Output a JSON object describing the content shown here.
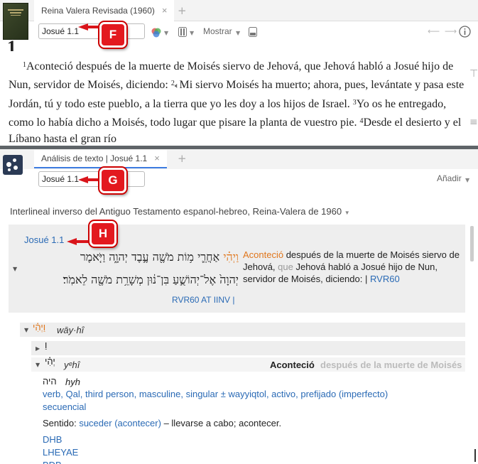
{
  "top_pane": {
    "tab_title": "Reina Valera Revisada (1960)",
    "tab_close": "×",
    "new_tab": "+",
    "reference": "Josué 1.1",
    "mostrar_label": "Mostrar",
    "chapter_number": "1",
    "verses": [
      {
        "num": "1",
        "text": "Aconteció después de la muerte de Moisés siervo de Jehová, que Jehová habló a Josué hijo de Nun, servidor de Moisés, diciendo: "
      },
      {
        "num": "2",
        "text": "Mi siervo Moisés ha muerto; ahora, pues, levántate y pasa este Jordán, tú y todo este pueblo, a la tierra que yo les doy a los hijos de Israel. "
      },
      {
        "num": "3",
        "text": "Yo os he entregado, como lo había dicho a Moisés, todo lugar que pisare la planta de vuestro pie. "
      },
      {
        "num": "4",
        "text": "Desde el desierto y el Líbano hasta el gran río"
      }
    ]
  },
  "bottom_pane": {
    "tab_title": "Análisis de texto | Josué 1.1",
    "tab_close": "×",
    "new_tab": "+",
    "reference": "Josué 1.1",
    "add_label": "Añadir",
    "resource_title": "Interlineal inverso del Antiguo Testamento espanol-hebreo, Reina-Valera de 1960",
    "passage": {
      "ref_link": "Josué 1.1",
      "hebrew_first_word": "וַיְהִ֗י",
      "hebrew_line1_rest": "אַחֲרֵ֛י מ֥וֹת מֹשֶׁ֖ה עֶ֣בֶד יְהוָ֑ה וַיֹּ֤אמֶר",
      "hebrew_line2": "יְהוָה֙ אֶל־יְהוֹשֻׁ֣עַ בִּן־נ֔וּן מְשָׁרֵ֥ת מֹשֶׁ֖ה לֵאמֹֽר׃",
      "version_links": "RVR60 AT IINV |",
      "spanish_first": "Aconteció",
      "spanish_mid1": " después de la muerte de Moisés siervo de Jehová, ",
      "spanish_que": "que",
      "spanish_rest": " Jehová habló a Josué hijo de Nun, servidor de Moisés, diciendo:",
      "spanish_sep": "|",
      "spanish_link": "RVR60"
    },
    "word_tree": {
      "row1_hebrew": "וַיְהִ֗י",
      "row1_translit": "wāy·hî",
      "row2_hebrew": "וַ",
      "row3_hebrew": "יְהִ֗י",
      "row3_translit": "yᵉhî",
      "row3_gloss_bold": "Aconteció",
      "row3_gloss_rest": "después de la muerte de Moisés"
    },
    "details": {
      "lemma_hebrew": "היה",
      "lemma_translit": "hyh",
      "morph": "verb, Qal, third person, masculine, singular ± wayyiqtol, activo, prefijado (imperfecto)",
      "morph2": "secuencial",
      "sense_label": "Sentido:",
      "sense_link": "suceder (acontecer)",
      "sense_rest": "– llevarse a cabo; acontecer.",
      "dict1": "DHB",
      "dict2": "LHEYAE",
      "dict3": "BDB"
    }
  },
  "callouts": {
    "f": "F",
    "g": "G",
    "h": "H"
  },
  "colors": {
    "accent_red": "#e3191f",
    "link_blue": "#2a6ab5",
    "orange_highlight": "#e0761c",
    "divider_gray": "#5f6468"
  }
}
